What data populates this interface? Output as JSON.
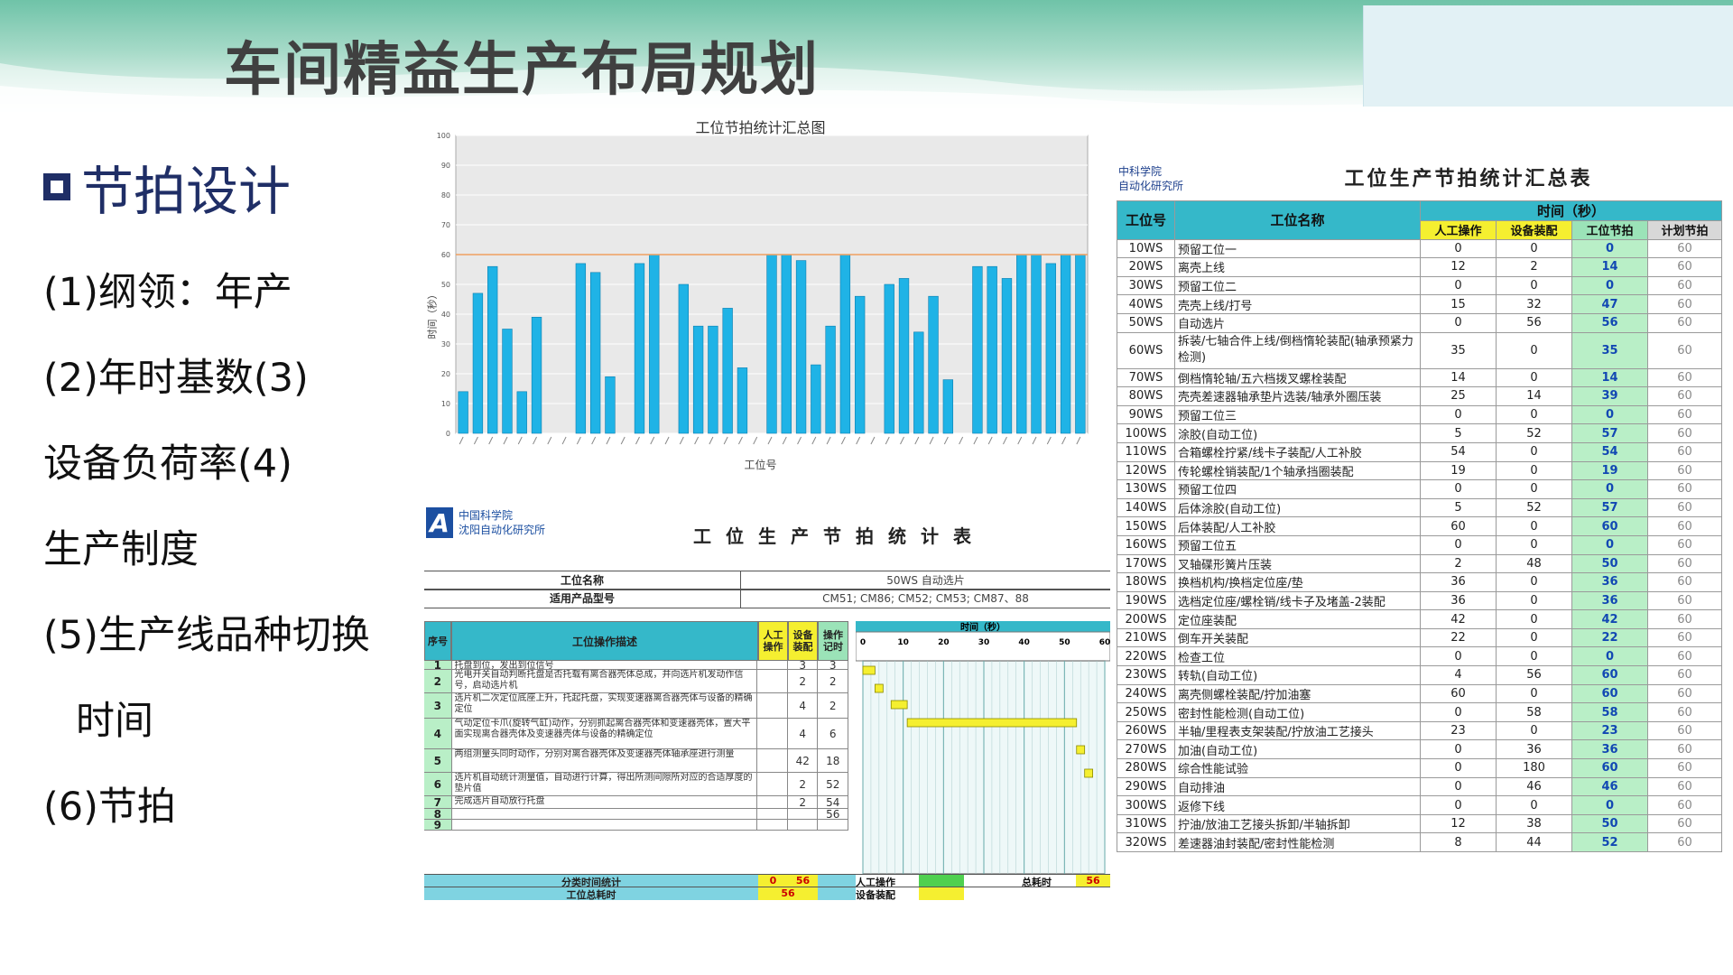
{
  "title": "车间精益生产布局规划",
  "left": {
    "section": "节拍设计",
    "items": [
      "(1)纲领：年产",
      "(2)年时基数(3)",
      "设备负荷率(4)",
      "生产制度",
      "(5)生产线品种切换",
      "时间",
      "(6)节拍"
    ]
  },
  "chart_data": {
    "type": "bar",
    "title": "工位节拍统计汇总图",
    "ylabel": "时间（秒）",
    "xlabel": "工位号",
    "ylim": [
      0,
      100
    ],
    "yticks": [
      0,
      10,
      20,
      30,
      40,
      50,
      60,
      70,
      80,
      90,
      100
    ],
    "reference_line": 60,
    "values": [
      14,
      47,
      56,
      35,
      14,
      39,
      0,
      0,
      57,
      54,
      19,
      0,
      57,
      60,
      0,
      50,
      36,
      36,
      42,
      22,
      0,
      60,
      60,
      58,
      23,
      36,
      60,
      46,
      0,
      50,
      52,
      34,
      46,
      18,
      0,
      56,
      56,
      52,
      60,
      60,
      57,
      60,
      60
    ],
    "colors": {
      "bar": "#1fb3e6",
      "reference": "#f0a060",
      "plot_bg": "#e9e9e9"
    }
  },
  "summary": {
    "logo": [
      "中科学院",
      "自动化研究所"
    ],
    "title": "工位生产节拍统计汇总表",
    "headers": {
      "station": "工位号",
      "name": "工位名称",
      "time": "时间（秒）",
      "manual": "人工操作",
      "equip": "设备装配",
      "cycle": "工位节拍",
      "plan": "计划节拍"
    },
    "rows": [
      {
        "id": "10WS",
        "name": "预留工位一",
        "m": "0",
        "e": "0",
        "c": "0",
        "p": "60"
      },
      {
        "id": "20WS",
        "name": "离壳上线",
        "m": "12",
        "e": "2",
        "c": "14",
        "p": "60"
      },
      {
        "id": "30WS",
        "name": "预留工位二",
        "m": "0",
        "e": "0",
        "c": "0",
        "p": "60"
      },
      {
        "id": "40WS",
        "name": "壳壳上线/打号",
        "m": "15",
        "e": "32",
        "c": "47",
        "p": "60"
      },
      {
        "id": "50WS",
        "name": "自动选片",
        "m": "0",
        "e": "56",
        "c": "56",
        "p": "60"
      },
      {
        "id": "60WS",
        "name": "拆装/七轴合件上线/倒档惰轮装配(轴承预紧力检测)",
        "m": "35",
        "e": "0",
        "c": "35",
        "p": "60"
      },
      {
        "id": "70WS",
        "name": "倒档惰轮轴/五六档拨叉螺栓装配",
        "m": "14",
        "e": "0",
        "c": "14",
        "p": "60"
      },
      {
        "id": "80WS",
        "name": "壳壳差速器轴承垫片选装/轴承外圈压装",
        "m": "25",
        "e": "14",
        "c": "39",
        "p": "60"
      },
      {
        "id": "90WS",
        "name": "预留工位三",
        "m": "0",
        "e": "0",
        "c": "0",
        "p": "60"
      },
      {
        "id": "100WS",
        "name": "涂胶(自动工位)",
        "m": "5",
        "e": "52",
        "c": "57",
        "p": "60"
      },
      {
        "id": "110WS",
        "name": "合箱螺栓拧紧/线卡子装配/人工补胶",
        "m": "54",
        "e": "0",
        "c": "54",
        "p": "60"
      },
      {
        "id": "120WS",
        "name": "传轮螺栓销装配/1个轴承挡圈装配",
        "m": "19",
        "e": "0",
        "c": "19",
        "p": "60"
      },
      {
        "id": "130WS",
        "name": "预留工位四",
        "m": "0",
        "e": "0",
        "c": "0",
        "p": "60"
      },
      {
        "id": "140WS",
        "name": "后体涂胶(自动工位)",
        "m": "5",
        "e": "52",
        "c": "57",
        "p": "60"
      },
      {
        "id": "150WS",
        "name": "后体装配/人工补胶",
        "m": "60",
        "e": "0",
        "c": "60",
        "p": "60"
      },
      {
        "id": "160WS",
        "name": "预留工位五",
        "m": "0",
        "e": "0",
        "c": "0",
        "p": "60"
      },
      {
        "id": "170WS",
        "name": "叉轴碟形簧片压装",
        "m": "2",
        "e": "48",
        "c": "50",
        "p": "60"
      },
      {
        "id": "180WS",
        "name": "换档机构/换档定位座/垫",
        "m": "36",
        "e": "0",
        "c": "36",
        "p": "60"
      },
      {
        "id": "190WS",
        "name": "选档定位座/螺栓销/线卡子及堵盖-2装配",
        "m": "36",
        "e": "0",
        "c": "36",
        "p": "60"
      },
      {
        "id": "200WS",
        "name": "定位座装配",
        "m": "42",
        "e": "0",
        "c": "42",
        "p": "60"
      },
      {
        "id": "210WS",
        "name": "倒车开关装配",
        "m": "22",
        "e": "0",
        "c": "22",
        "p": "60"
      },
      {
        "id": "220WS",
        "name": "检查工位",
        "m": "0",
        "e": "0",
        "c": "0",
        "p": "60"
      },
      {
        "id": "230WS",
        "name": "转轨(自动工位)",
        "m": "4",
        "e": "56",
        "c": "60",
        "p": "60"
      },
      {
        "id": "240WS",
        "name": "离壳侧螺栓装配/拧加油塞",
        "m": "60",
        "e": "0",
        "c": "60",
        "p": "60"
      },
      {
        "id": "250WS",
        "name": "密封性能检测(自动工位)",
        "m": "0",
        "e": "58",
        "c": "58",
        "p": "60"
      },
      {
        "id": "260WS",
        "name": "半轴/里程表支架装配/拧放油工艺接头",
        "m": "23",
        "e": "0",
        "c": "23",
        "p": "60"
      },
      {
        "id": "270WS",
        "name": "加油(自动工位)",
        "m": "0",
        "e": "36",
        "c": "36",
        "p": "60"
      },
      {
        "id": "280WS",
        "name": "综合性能试验",
        "m": "0",
        "e": "180",
        "c": "60",
        "p": "60"
      },
      {
        "id": "290WS",
        "name": "自动排油",
        "m": "0",
        "e": "46",
        "c": "46",
        "p": "60"
      },
      {
        "id": "300WS",
        "name": "返修下线",
        "m": "0",
        "e": "0",
        "c": "0",
        "p": "60"
      },
      {
        "id": "310WS",
        "name": "拧油/放油工艺接头拆卸/半轴拆卸",
        "m": "12",
        "e": "38",
        "c": "50",
        "p": "60"
      },
      {
        "id": "320WS",
        "name": "差速器油封装配/密封性能检测",
        "m": "8",
        "e": "44",
        "c": "52",
        "p": "60"
      }
    ]
  },
  "detail": {
    "logo_mark": "A",
    "logo": [
      "中国科学院",
      "沈阳自动化研究所"
    ],
    "title": "工位生产节拍统计表",
    "station_label": "工位名称",
    "station_value": "50WS 自动选片",
    "product_label": "适用产品型号",
    "product_value": "CM51; CM86; CM52; CM53; CM87、88",
    "col_seq": "序号",
    "col_desc": "工位操作描述",
    "col_manual": "人工操作",
    "col_equip": "设备装配",
    "col_record": "操作记时",
    "time_header": "时间（秒）",
    "time_ticks": [
      "0",
      "10",
      "20",
      "30",
      "40",
      "50",
      "60"
    ],
    "rows": [
      {
        "seq": "1",
        "desc": "托盘到位，发出到位信号",
        "m": "",
        "e": "3",
        "r": "3"
      },
      {
        "seq": "2",
        "desc": "光电开关自动判断托盘是否托载有离合器壳体总成，并向选片机发动作信号，启动选片机",
        "m": "",
        "e": "2",
        "r": "2"
      },
      {
        "seq": "3",
        "desc": "选片机二次定位底座上升，托起托盘，实现变速器离合器壳体与设备的精确定位",
        "m": "",
        "e": "4",
        "r": "2"
      },
      {
        "seq": "4",
        "desc": "气动定位卡爪(旋转气缸)动作，分别抓起离合器壳体和变速器壳体，置大平面实现离合器壳体及变速器壳体与设备的精确定位",
        "m": "",
        "e": "4",
        "r": "6"
      },
      {
        "seq": "5",
        "desc": "两组测量头同时动作，分别对离合器壳体及变速器壳体轴承座进行测量",
        "m": "",
        "e": "42",
        "r": "18"
      },
      {
        "seq": "6",
        "desc": "选片机自动统计测量值，自动进行计算，得出所测间隙所对应的合适厚度的垫片值",
        "m": "",
        "e": "2",
        "r": "52"
      },
      {
        "seq": "7",
        "desc": "完成选片自动放行托盘",
        "m": "",
        "e": "2",
        "r": "54"
      },
      {
        "seq": "8",
        "desc": "",
        "m": "",
        "e": "",
        "r": "56"
      },
      {
        "seq": "9",
        "desc": "",
        "m": "",
        "e": "",
        "r": ""
      }
    ],
    "gantt": [
      [
        0,
        3
      ],
      [
        3,
        5
      ],
      [
        7,
        11
      ],
      [
        11,
        53
      ],
      [
        53,
        55
      ],
      [
        55,
        57
      ]
    ],
    "foot_label1": "分类时间统计",
    "foot_m": "0",
    "foot_e": "56",
    "foot_label2": "工位总耗时",
    "foot_total": "56",
    "legend_manual": "人工操作",
    "legend_equip": "设备装配",
    "total_label": "总耗时",
    "total_value": "56"
  }
}
